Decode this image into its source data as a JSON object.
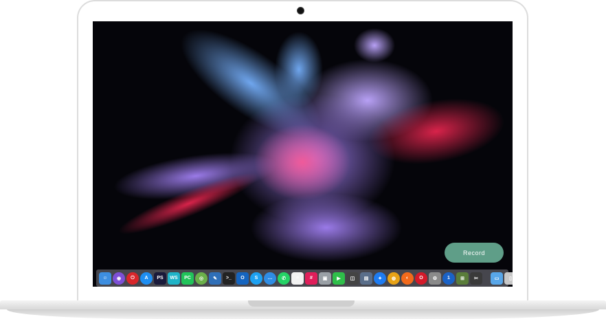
{
  "record": {
    "label": "Record"
  },
  "dock": {
    "apps": [
      {
        "name": "finder-icon",
        "glyph": "☺",
        "color": "#3d8ee0",
        "round": false
      },
      {
        "name": "siri-icon",
        "glyph": "◉",
        "color": "#7d4fd6",
        "round": true
      },
      {
        "name": "power-icon",
        "glyph": "⏻",
        "color": "#d9262a",
        "round": true
      },
      {
        "name": "app-store-icon",
        "glyph": "A",
        "color": "#1e8ef2",
        "round": true
      },
      {
        "name": "photoshop-icon",
        "glyph": "PS",
        "color": "#1a1a3a",
        "round": false
      },
      {
        "name": "webstorm-icon",
        "glyph": "WS",
        "color": "#20b4c8",
        "round": false
      },
      {
        "name": "pycharm-icon",
        "glyph": "PC",
        "color": "#21c35a",
        "round": false
      },
      {
        "name": "android-studio-icon",
        "glyph": "◎",
        "color": "#6bb04a",
        "round": true
      },
      {
        "name": "xcode-icon",
        "glyph": "✎",
        "color": "#2f6fb8",
        "round": false
      },
      {
        "name": "terminal-icon",
        "glyph": ">_",
        "color": "#222",
        "round": false
      },
      {
        "name": "outlook-icon",
        "glyph": "O",
        "color": "#1565c0",
        "round": false
      },
      {
        "name": "skype-icon",
        "glyph": "S",
        "color": "#1da1f2",
        "round": true
      },
      {
        "name": "messages-icon",
        "glyph": "…",
        "color": "#2f8de4",
        "round": true
      },
      {
        "name": "whatsapp-icon",
        "glyph": "✆",
        "color": "#25d366",
        "round": true
      },
      {
        "name": "notes-icon",
        "glyph": "≡",
        "color": "#f2f2f2",
        "round": false
      },
      {
        "name": "slack-icon",
        "glyph": "#",
        "color": "#e01e5a",
        "round": false
      },
      {
        "name": "preview-icon",
        "glyph": "▣",
        "color": "#9aa0a6",
        "round": false
      },
      {
        "name": "facetime-icon",
        "glyph": "▶",
        "color": "#2fbf4a",
        "round": false
      },
      {
        "name": "photo-booth-icon",
        "glyph": "◫",
        "color": "#444",
        "round": false
      },
      {
        "name": "image-capture-icon",
        "glyph": "▤",
        "color": "#5a6e8a",
        "round": false
      },
      {
        "name": "safari-icon",
        "glyph": "✦",
        "color": "#1e7cf2",
        "round": true
      },
      {
        "name": "chrome-icon",
        "glyph": "◍",
        "color": "#e8a317",
        "round": true
      },
      {
        "name": "firefox-icon",
        "glyph": "◐",
        "color": "#f26a1b",
        "round": true
      },
      {
        "name": "opera-icon",
        "glyph": "O",
        "color": "#d41a2a",
        "round": true
      },
      {
        "name": "system-preferences-icon",
        "glyph": "⚙",
        "color": "#8a8a8a",
        "round": false
      },
      {
        "name": "1password-icon",
        "glyph": "1",
        "color": "#1a62c7",
        "round": true
      },
      {
        "name": "grapher-icon",
        "glyph": "⊞",
        "color": "#5a7d3a",
        "round": false
      },
      {
        "name": "utility-icon",
        "glyph": "✂",
        "color": "#3a3a3a",
        "round": false
      }
    ],
    "trailing": [
      {
        "name": "downloads-folder-icon",
        "glyph": "▭",
        "color": "#58a6e8",
        "round": false
      },
      {
        "name": "trash-icon",
        "glyph": "▯",
        "color": "#c8c8c8",
        "round": false
      }
    ]
  }
}
